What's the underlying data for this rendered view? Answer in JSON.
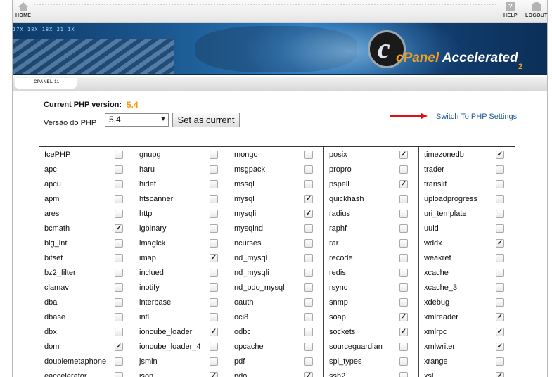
{
  "topbar": {
    "home_label": "HOME",
    "help_label": "HELP",
    "help_glyph": "?",
    "logout_label": "LOGOUT",
    "icons": {
      "home": "home-icon",
      "help": "help-icon",
      "logout": "user-icon"
    }
  },
  "banner": {
    "ticker": "17X   18X   18X   21  1X",
    "logo_c": "c",
    "logo_brand": "cPanel",
    "logo_suffix": " Accelerated",
    "logo_version": "2"
  },
  "breadcrumb": {
    "label": "CPANEL 11"
  },
  "php": {
    "current_label": "Current PHP version:",
    "current_value": "5.4",
    "version_label": "Versão do PHP",
    "selected_version": "5.4",
    "set_button_label": "Set as current",
    "switch_link_label": "Switch To PHP Settings",
    "accent_color": "#f39c12",
    "link_color": "#1f5b99",
    "arrow_color": "#e01010"
  },
  "extensions": {
    "columns": [
      [
        {
          "name": "IcePHP",
          "checked": false
        },
        {
          "name": "apc",
          "checked": false
        },
        {
          "name": "apcu",
          "checked": false
        },
        {
          "name": "apm",
          "checked": false
        },
        {
          "name": "ares",
          "checked": false
        },
        {
          "name": "bcmath",
          "checked": true
        },
        {
          "name": "big_int",
          "checked": false
        },
        {
          "name": "bitset",
          "checked": false
        },
        {
          "name": "bz2_filter",
          "checked": false
        },
        {
          "name": "clamav",
          "checked": false
        },
        {
          "name": "dba",
          "checked": false
        },
        {
          "name": "dbase",
          "checked": false
        },
        {
          "name": "dbx",
          "checked": false
        },
        {
          "name": "dom",
          "checked": true
        },
        {
          "name": "doublemetaphone",
          "checked": false
        },
        {
          "name": "eaccelerator",
          "checked": false
        }
      ],
      [
        {
          "name": "gnupg",
          "checked": false
        },
        {
          "name": "haru",
          "checked": false
        },
        {
          "name": "hidef",
          "checked": false
        },
        {
          "name": "htscanner",
          "checked": false
        },
        {
          "name": "http",
          "checked": false
        },
        {
          "name": "igbinary",
          "checked": false
        },
        {
          "name": "imagick",
          "checked": false
        },
        {
          "name": "imap",
          "checked": true
        },
        {
          "name": "inclued",
          "checked": false
        },
        {
          "name": "inotify",
          "checked": false
        },
        {
          "name": "interbase",
          "checked": false
        },
        {
          "name": "intl",
          "checked": false
        },
        {
          "name": "ioncube_loader",
          "checked": true
        },
        {
          "name": "ioncube_loader_4",
          "checked": false
        },
        {
          "name": "jsmin",
          "checked": false
        },
        {
          "name": "json",
          "checked": true
        }
      ],
      [
        {
          "name": "mongo",
          "checked": false
        },
        {
          "name": "msgpack",
          "checked": false
        },
        {
          "name": "mssql",
          "checked": false
        },
        {
          "name": "mysql",
          "checked": true
        },
        {
          "name": "mysqli",
          "checked": true
        },
        {
          "name": "mysqlnd",
          "checked": false
        },
        {
          "name": "ncurses",
          "checked": false
        },
        {
          "name": "nd_mysql",
          "checked": false
        },
        {
          "name": "nd_mysqli",
          "checked": false
        },
        {
          "name": "nd_pdo_mysql",
          "checked": false
        },
        {
          "name": "oauth",
          "checked": false
        },
        {
          "name": "oci8",
          "checked": false
        },
        {
          "name": "odbc",
          "checked": false
        },
        {
          "name": "opcache",
          "checked": false
        },
        {
          "name": "pdf",
          "checked": false
        },
        {
          "name": "pdo",
          "checked": true
        }
      ],
      [
        {
          "name": "posix",
          "checked": true
        },
        {
          "name": "propro",
          "checked": false
        },
        {
          "name": "pspell",
          "checked": true
        },
        {
          "name": "quickhash",
          "checked": false
        },
        {
          "name": "radius",
          "checked": false
        },
        {
          "name": "raphf",
          "checked": false
        },
        {
          "name": "rar",
          "checked": false
        },
        {
          "name": "recode",
          "checked": false
        },
        {
          "name": "redis",
          "checked": false
        },
        {
          "name": "rsync",
          "checked": false
        },
        {
          "name": "snmp",
          "checked": false
        },
        {
          "name": "soap",
          "checked": true
        },
        {
          "name": "sockets",
          "checked": true
        },
        {
          "name": "sourceguardian",
          "checked": false
        },
        {
          "name": "spl_types",
          "checked": false
        },
        {
          "name": "ssh2",
          "checked": false
        }
      ],
      [
        {
          "name": "timezonedb",
          "checked": true
        },
        {
          "name": "trader",
          "checked": false
        },
        {
          "name": "translit",
          "checked": false
        },
        {
          "name": "uploadprogress",
          "checked": false
        },
        {
          "name": "uri_template",
          "checked": false
        },
        {
          "name": "uuid",
          "checked": false
        },
        {
          "name": "wddx",
          "checked": true
        },
        {
          "name": "weakref",
          "checked": false
        },
        {
          "name": "xcache",
          "checked": false
        },
        {
          "name": "xcache_3",
          "checked": false
        },
        {
          "name": "xdebug",
          "checked": false
        },
        {
          "name": "xmlreader",
          "checked": true
        },
        {
          "name": "xmlrpc",
          "checked": true
        },
        {
          "name": "xmlwriter",
          "checked": true
        },
        {
          "name": "xrange",
          "checked": false
        },
        {
          "name": "xsl",
          "checked": true
        }
      ]
    ],
    "check_glyph": "✓"
  }
}
